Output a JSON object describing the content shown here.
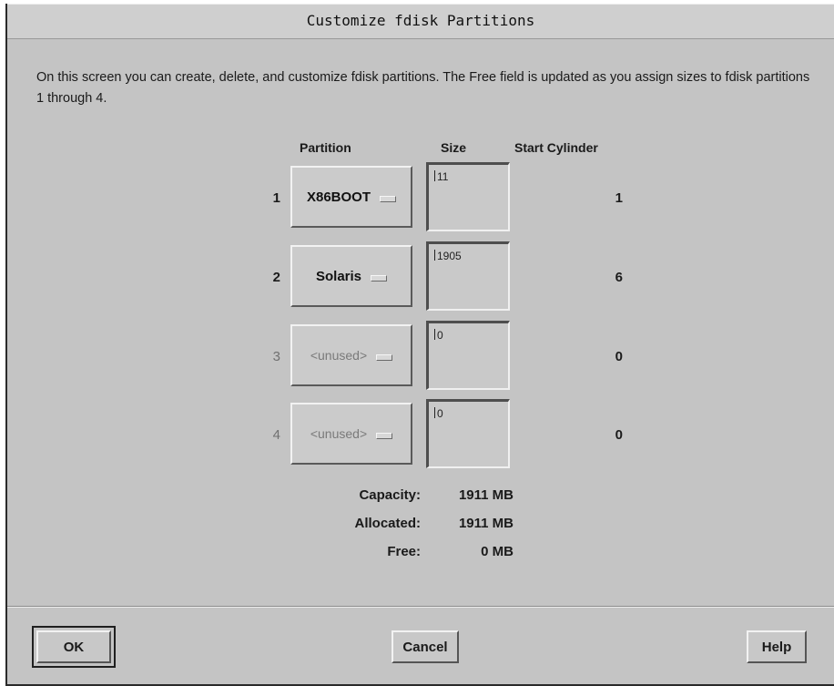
{
  "dialog": {
    "title": "Customize fdisk Partitions",
    "description": "On this screen you can create, delete, and customize fdisk partitions. The Free field is updated as you assign sizes to fdisk partitions 1 through 4."
  },
  "columns": {
    "partition": "Partition",
    "size": "Size",
    "start_cylinder": "Start Cylinder"
  },
  "partitions": [
    {
      "number": "1",
      "type": "X86BOOT",
      "size": "11",
      "start_cylinder": "1",
      "enabled": true
    },
    {
      "number": "2",
      "type": "Solaris",
      "size": "1905",
      "start_cylinder": "6",
      "enabled": true
    },
    {
      "number": "3",
      "type": "<unused>",
      "size": "0",
      "start_cylinder": "0",
      "enabled": false
    },
    {
      "number": "4",
      "type": "<unused>",
      "size": "0",
      "start_cylinder": "0",
      "enabled": false
    }
  ],
  "summary": {
    "capacity_label": "Capacity:",
    "capacity_value": "1911 MB",
    "allocated_label": "Allocated:",
    "allocated_value": "1911 MB",
    "free_label": "Free:",
    "free_value": "0 MB"
  },
  "buttons": {
    "ok": "OK",
    "cancel": "Cancel",
    "help": "Help"
  },
  "icons": {
    "option_menu_indicator": "option-menu-indicator-icon",
    "text_cursor": "text-cursor-icon"
  },
  "colors": {
    "dialog_background": "#c4c4c4",
    "disabled_text": "#7a7a7a"
  }
}
